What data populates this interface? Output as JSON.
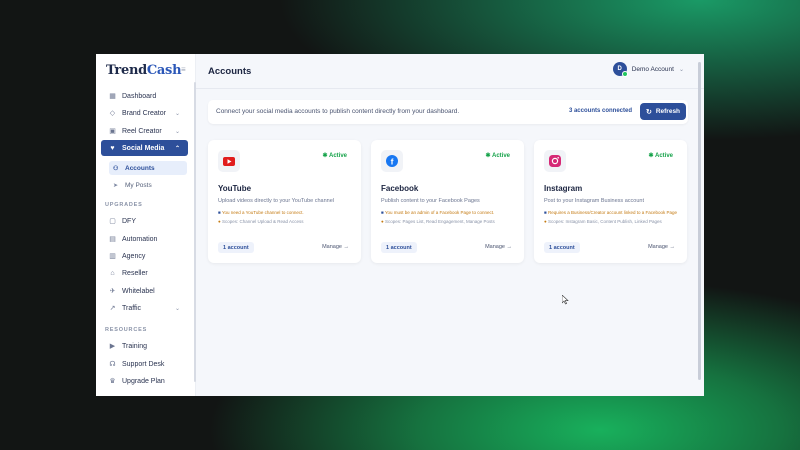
{
  "brand": {
    "logo_main": "Trend",
    "logo_accent": "Cash"
  },
  "header": {
    "title": "Accounts",
    "account_initial": "D",
    "account_name": "Demo Account"
  },
  "sidebar": {
    "items": [
      {
        "label": "Dashboard",
        "icon": "grid-icon"
      },
      {
        "label": "Brand Creator",
        "icon": "tag-icon",
        "has_chevron": true
      },
      {
        "label": "Reel Creator",
        "icon": "film-icon",
        "has_chevron": true
      },
      {
        "label": "Social Media",
        "icon": "heart-icon",
        "has_chevron": true,
        "active": true
      }
    ],
    "sub_items": [
      {
        "label": "Accounts",
        "icon": "users-icon",
        "active": true
      },
      {
        "label": "My Posts",
        "icon": "send-icon"
      }
    ],
    "upgrades_label": "UPGRADES",
    "upgrades": [
      {
        "label": "DFY",
        "icon": "box-icon"
      },
      {
        "label": "Automation",
        "icon": "cpu-icon"
      },
      {
        "label": "Agency",
        "icon": "building-icon"
      },
      {
        "label": "Reseller",
        "icon": "store-icon"
      },
      {
        "label": "Whitelabel",
        "icon": "rocket-icon"
      },
      {
        "label": "Traffic",
        "icon": "trending-icon",
        "has_chevron": true
      }
    ],
    "resources_label": "RESOURCES",
    "resources": [
      {
        "label": "Training",
        "icon": "video-icon"
      },
      {
        "label": "Support Desk",
        "icon": "headset-icon"
      },
      {
        "label": "Upgrade Plan",
        "icon": "crown-icon"
      }
    ]
  },
  "banner": {
    "text": "Connect your social media accounts to publish content directly from your dashboard.",
    "count": "3 accounts connected",
    "refresh_label": "Refresh"
  },
  "cards": [
    {
      "name": "YouTube",
      "status": "Active",
      "description": "Upload videos directly to your YouTube channel",
      "note": "You need a YouTube channel to connect.",
      "scopes": "Scopes: Channel Upload & Read Access",
      "badge": "1 account",
      "manage": "Manage →",
      "color": "#e11d1d"
    },
    {
      "name": "Facebook",
      "status": "Active",
      "description": "Publish content to your Facebook Pages",
      "note": "You must be an admin of a Facebook Page to connect.",
      "scopes": "Scopes: Pages List, Read Engagement, Manage Posts",
      "badge": "1 account",
      "manage": "Manage →",
      "color": "#1877f2"
    },
    {
      "name": "Instagram",
      "status": "Active",
      "description": "Post to your Instagram Business account",
      "note": "Requires a Business/Creator account linked to a Facebook Page",
      "scopes": "Scopes: Instagram Basic, Content Publish, Linked Pages",
      "badge": "1 account",
      "manage": "Manage →",
      "color": "#d62976"
    }
  ]
}
